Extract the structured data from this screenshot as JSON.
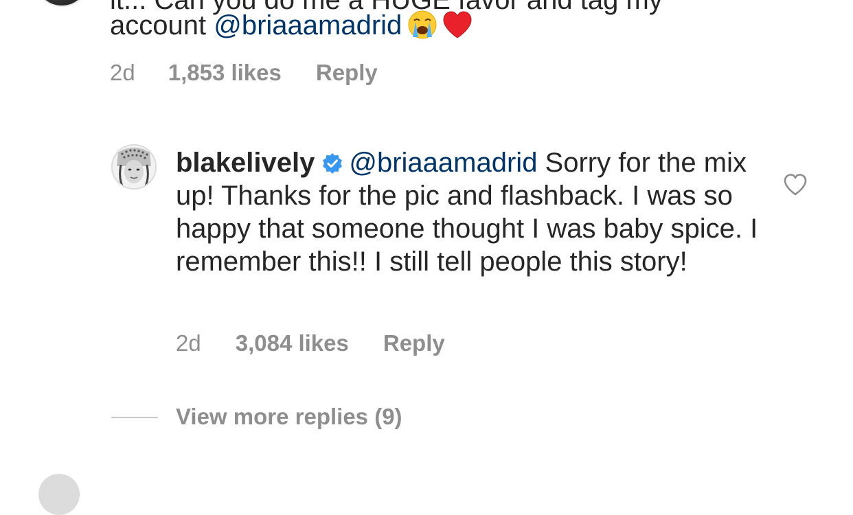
{
  "comment_top": {
    "cut_line": "it... Can you do me a HUGE favor and tag my",
    "line2_text": "account ",
    "mention": "@briaaamadrid",
    "time": "2d",
    "likes": "1,853 likes",
    "reply_label": "Reply"
  },
  "comment_reply": {
    "username": "blakelively",
    "mention": "@briaaamadrid",
    "text": " Sorry for the mix up! Thanks for the pic and flashback. I was so happy that someone thought I was baby spice. I remember this!! I still tell people this story!",
    "time": "2d",
    "likes": "3,084 likes",
    "reply_label": "Reply",
    "verified_icon": "verified-badge",
    "like_icon": "heart-outline"
  },
  "view_more": {
    "label": "View more replies (9)"
  },
  "colors": {
    "mention": "#003569",
    "meta": "#8e8e8e",
    "verified": "#3897f0"
  }
}
